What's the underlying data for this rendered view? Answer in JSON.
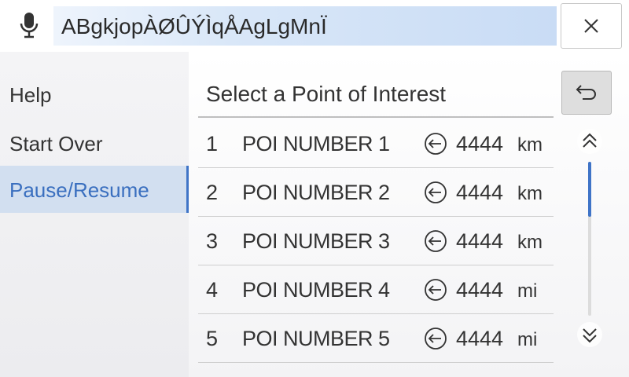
{
  "search": {
    "query": "ABgkjopÀØÛÝÌqÅAgLgMnÏ",
    "mic_icon": "microphone-icon",
    "close_icon": "close-icon"
  },
  "sidebar": {
    "items": [
      {
        "label": "Help",
        "active": false
      },
      {
        "label": "Start Over",
        "active": false
      },
      {
        "label": "Pause/Resume",
        "active": true
      }
    ],
    "accent_color": "#3f74c7"
  },
  "main": {
    "title": "Select a Point of Interest",
    "back_icon": "return-arrow-icon",
    "rows": [
      {
        "num": "1",
        "name": "POI NUMBER 1",
        "direction_icon": "left-arrow-circle-icon",
        "distance": "4444",
        "unit": "km"
      },
      {
        "num": "2",
        "name": "POI NUMBER 2",
        "direction_icon": "left-arrow-circle-icon",
        "distance": "4444",
        "unit": "km"
      },
      {
        "num": "3",
        "name": "POI NUMBER 3",
        "direction_icon": "left-arrow-circle-icon",
        "distance": "4444",
        "unit": "km"
      },
      {
        "num": "4",
        "name": "POI NUMBER 4",
        "direction_icon": "left-arrow-circle-icon",
        "distance": "4444",
        "unit": "mi"
      },
      {
        "num": "5",
        "name": "POI NUMBER 5",
        "direction_icon": "left-arrow-circle-icon",
        "distance": "4444",
        "unit": "mi"
      }
    ]
  },
  "scrollbar": {
    "up_icon": "double-chevron-up-icon",
    "down_icon": "double-chevron-down-icon"
  }
}
